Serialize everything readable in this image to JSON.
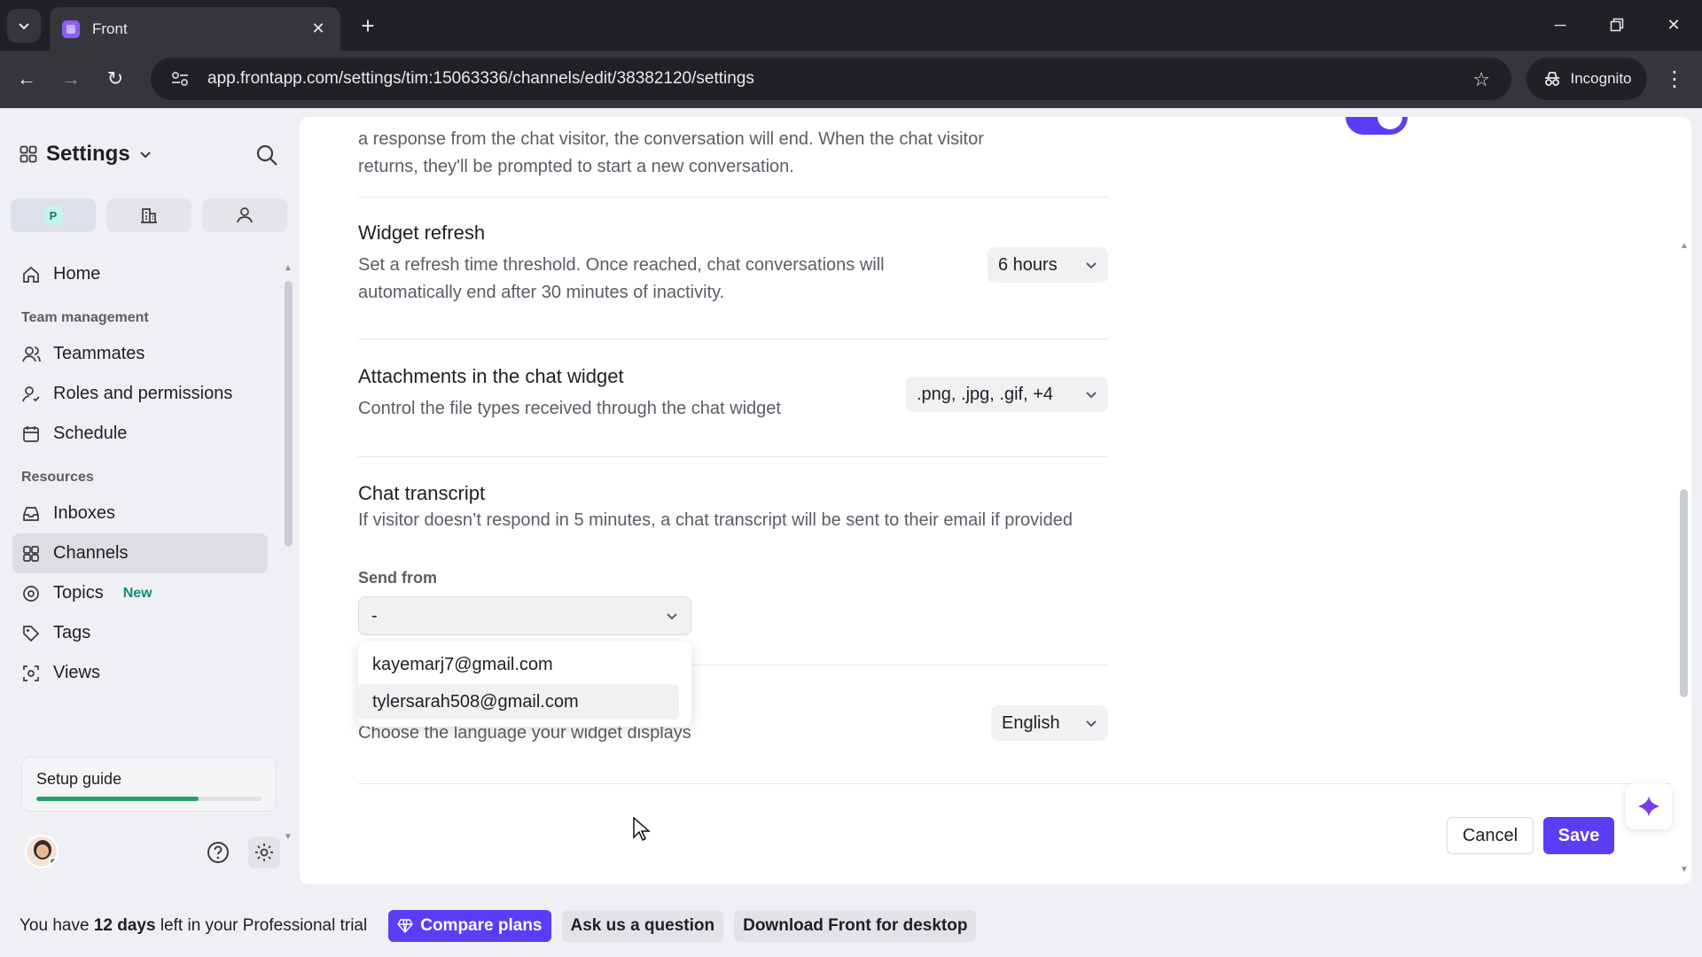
{
  "browser": {
    "tab_title": "Front",
    "url": "app.frontapp.com/settings/tim:15063336/channels/edit/38382120/settings",
    "incognito_label": "Incognito"
  },
  "sidebar": {
    "title": "Settings",
    "switch_badge": "P",
    "home": "Home",
    "team_management_heading": "Team management",
    "teammates": "Teammates",
    "roles": "Roles and permissions",
    "schedule": "Schedule",
    "resources_heading": "Resources",
    "inboxes": "Inboxes",
    "channels": "Channels",
    "topics": "Topics",
    "topics_badge": "New",
    "tags": "Tags",
    "views": "Views",
    "setup_guide": "Setup guide",
    "setup_progress": 0.72
  },
  "settings": {
    "inactivity_text": "a response from the chat visitor, the conversation will end. When the chat visitor returns, they'll be prompted to start a new conversation.",
    "widget_refresh_title": "Widget refresh",
    "widget_refresh_desc": "Set a refresh time threshold. Once reached, chat conversations will automatically end after 30 minutes of inactivity.",
    "widget_refresh_value": "6 hours",
    "attachments_title": "Attachments in the chat widget",
    "attachments_desc": "Control the file types received through the chat widget",
    "attachments_value": ".png, .jpg, .gif, +4",
    "transcript_title": "Chat transcript",
    "transcript_desc": "If visitor doesn’t respond in 5 minutes, a chat transcript will be sent to their email if provided",
    "send_from_label": "Send from",
    "send_from_value": "-",
    "send_from_options": [
      "kayemarj7@gmail.com",
      "tylersarah508@gmail.com"
    ],
    "language_desc": "Choose the language your widget displays",
    "language_value": "English"
  },
  "actions": {
    "cancel": "Cancel",
    "save": "Save"
  },
  "trial": {
    "prefix": "You have",
    "days": "12 days",
    "suffix": "left in your Professional trial",
    "compare": "Compare plans",
    "ask": "Ask us a question",
    "download": "Download Front for desktop"
  },
  "colors": {
    "accent": "#5b3df5",
    "progress": "#22a06b",
    "badge": "#0f8f7a"
  }
}
